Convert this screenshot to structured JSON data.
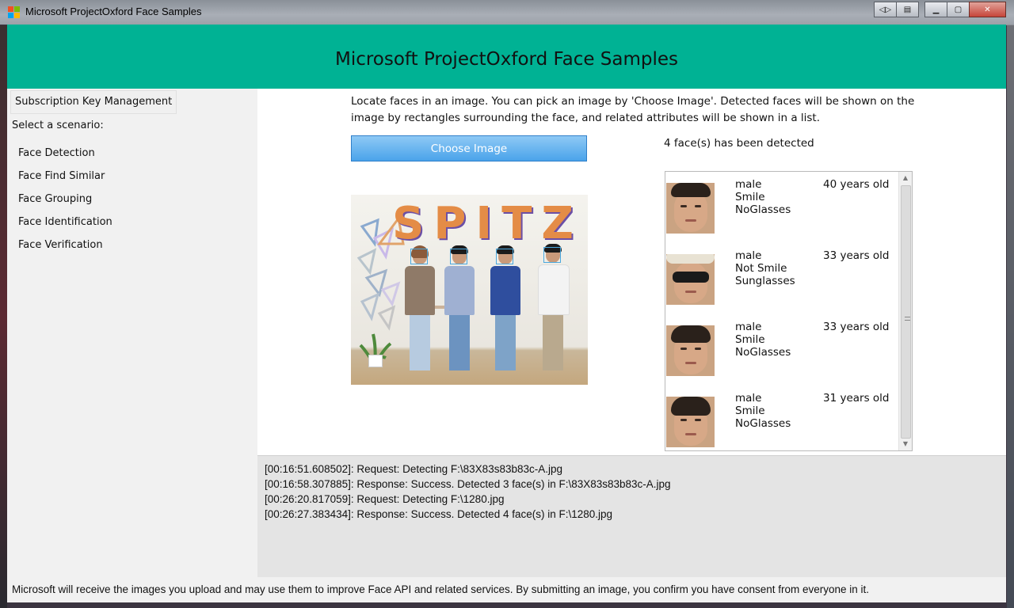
{
  "window": {
    "title": "Microsoft ProjectOxford Face Samples",
    "buttons": [
      "restore-icon",
      "snap-icon",
      "minimize-icon",
      "maximize-icon",
      "close-icon"
    ]
  },
  "header": {
    "title": "Microsoft ProjectOxford Face Samples"
  },
  "sidebar": {
    "subscription_button": "Subscription Key Management",
    "scenario_label": "Select a scenario:",
    "items": [
      {
        "label": "Face Detection"
      },
      {
        "label": "Face Find Similar"
      },
      {
        "label": "Face Grouping"
      },
      {
        "label": "Face Identification"
      },
      {
        "label": "Face Verification"
      }
    ]
  },
  "main": {
    "description": "Locate faces in an image. You can pick an image by 'Choose Image'. Detected faces will be shown on the image by rectangles surrounding the face, and related attributes will be shown in a list.",
    "choose_button": "Choose Image",
    "detect_count": "4 face(s) has been detected",
    "photo_title": "SPITZ",
    "faces": [
      {
        "gender": "male",
        "smile": "Smile",
        "glasses": "NoGlasses",
        "age": "40 years old"
      },
      {
        "gender": "male",
        "smile": "Not Smile",
        "glasses": "Sunglasses",
        "age": "33 years old"
      },
      {
        "gender": "male",
        "smile": "Smile",
        "glasses": "NoGlasses",
        "age": "33 years old"
      },
      {
        "gender": "male",
        "smile": "Smile",
        "glasses": "NoGlasses",
        "age": "31 years old"
      }
    ]
  },
  "log": [
    "[00:16:51.608502]: Request: Detecting F:\\83X83s83b83c-A.jpg",
    "[00:16:58.307885]: Response: Success. Detected 3 face(s) in F:\\83X83s83b83c-A.jpg",
    "[00:26:20.817059]: Request: Detecting F:\\1280.jpg",
    "[00:26:27.383434]: Response: Success. Detected 4 face(s) in F:\\1280.jpg"
  ],
  "footer": "Microsoft will receive the images you upload and may use them to improve Face API and related services. By submitting an image, you confirm you have consent from everyone in it.",
  "colors": {
    "accent": "#00b294",
    "button": "#4aa3ea",
    "face_box": "#4aa8df"
  }
}
